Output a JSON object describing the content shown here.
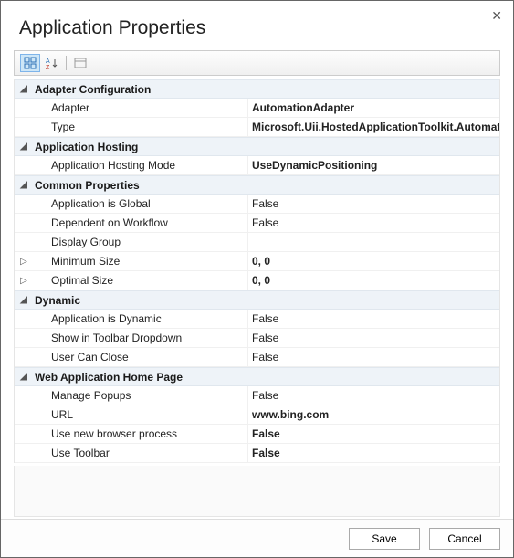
{
  "dialog": {
    "title": "Application Properties"
  },
  "categories": [
    {
      "name": "Adapter Configuration",
      "expanded": true,
      "props": [
        {
          "label": "Adapter",
          "value": "AutomationAdapter",
          "bold": true,
          "expandable": false
        },
        {
          "label": "Type",
          "value": "Microsoft.Uii.HostedApplicationToolkit.AutomationHosting.AutomationAdapter",
          "bold": true,
          "expandable": false
        }
      ]
    },
    {
      "name": "Application Hosting",
      "expanded": true,
      "props": [
        {
          "label": "Application Hosting Mode",
          "value": "UseDynamicPositioning",
          "bold": true,
          "expandable": false
        }
      ]
    },
    {
      "name": "Common Properties",
      "expanded": true,
      "props": [
        {
          "label": "Application is Global",
          "value": "False",
          "bold": false,
          "expandable": false
        },
        {
          "label": "Dependent on Workflow",
          "value": "False",
          "bold": false,
          "expandable": false
        },
        {
          "label": "Display Group",
          "value": "",
          "bold": false,
          "expandable": false
        },
        {
          "label": "Minimum Size",
          "value": "0, 0",
          "bold": true,
          "expandable": true
        },
        {
          "label": "Optimal Size",
          "value": "0, 0",
          "bold": true,
          "expandable": true
        }
      ]
    },
    {
      "name": "Dynamic",
      "expanded": true,
      "props": [
        {
          "label": "Application is Dynamic",
          "value": "False",
          "bold": false,
          "expandable": false
        },
        {
          "label": "Show in Toolbar Dropdown",
          "value": "False",
          "bold": false,
          "expandable": false
        },
        {
          "label": "User Can Close",
          "value": "False",
          "bold": false,
          "expandable": false
        }
      ]
    },
    {
      "name": "Web Application Home Page",
      "expanded": true,
      "props": [
        {
          "label": "Manage Popups",
          "value": "False",
          "bold": false,
          "expandable": false
        },
        {
          "label": "URL",
          "value": "www.bing.com",
          "bold": true,
          "expandable": false
        },
        {
          "label": "Use new browser process",
          "value": "False",
          "bold": true,
          "expandable": false
        },
        {
          "label": "Use Toolbar",
          "value": "False",
          "bold": true,
          "expandable": false
        }
      ]
    }
  ],
  "buttons": {
    "save": "Save",
    "cancel": "Cancel"
  }
}
